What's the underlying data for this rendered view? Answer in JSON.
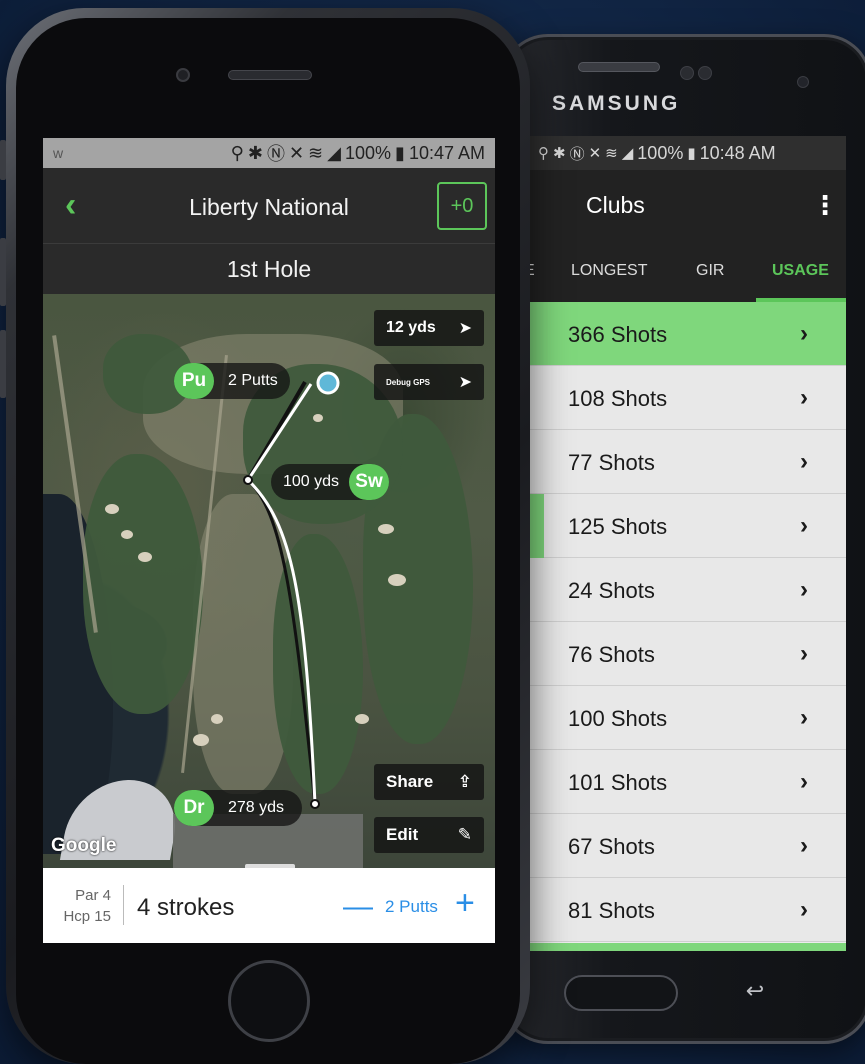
{
  "samsung": {
    "brand": "SAMSUNG",
    "status": {
      "battery": "100%",
      "time": "10:48 AM"
    },
    "appbar": {
      "title": "Clubs",
      "menu_icon": "more-vert-icon"
    },
    "tabs": [
      {
        "label": "E"
      },
      {
        "label": "LONGEST"
      },
      {
        "label": "GIR"
      },
      {
        "label": "USAGE",
        "active": true
      }
    ],
    "rows": [
      {
        "label": "366 Shots",
        "usage": 1.0
      },
      {
        "label": "108 Shots",
        "usage": 0.0
      },
      {
        "label": "77 Shots",
        "usage": 0.0
      },
      {
        "label": "125 Shots",
        "usage": 0.05
      },
      {
        "label": "24 Shots",
        "usage": 0.0
      },
      {
        "label": "76 Shots",
        "usage": 0.0
      },
      {
        "label": "100 Shots",
        "usage": 0.0
      },
      {
        "label": "101 Shots",
        "usage": 0.0
      },
      {
        "label": "67 Shots",
        "usage": 0.0
      },
      {
        "label": "81 Shots",
        "usage": 0.0
      }
    ],
    "accent": "#7fd77c"
  },
  "iphone": {
    "status": {
      "carrier": "ᴡ",
      "battery": "100%",
      "time": "10:47 AM"
    },
    "appbar": {
      "title": "Liberty National",
      "score": "+0",
      "back_icon": "chevron-left-icon"
    },
    "hole": {
      "title": "1st Hole"
    },
    "map": {
      "shots": [
        {
          "club": "Pu",
          "text": "2 Putts"
        },
        {
          "club": "Sw",
          "text": "100 yds"
        },
        {
          "club": "Dr",
          "text": "278 yds"
        }
      ],
      "distance_button": "12 yds",
      "debug_button": "Debug GPS",
      "share_label": "Share",
      "edit_label": "Edit",
      "attribution": "Google"
    },
    "footer": {
      "par": "Par 4",
      "hcp": "Hcp 15",
      "strokes": "4 strokes",
      "putts": "2 Putts"
    },
    "accent": "#5cc65a",
    "link_color": "#2a8ee6"
  }
}
